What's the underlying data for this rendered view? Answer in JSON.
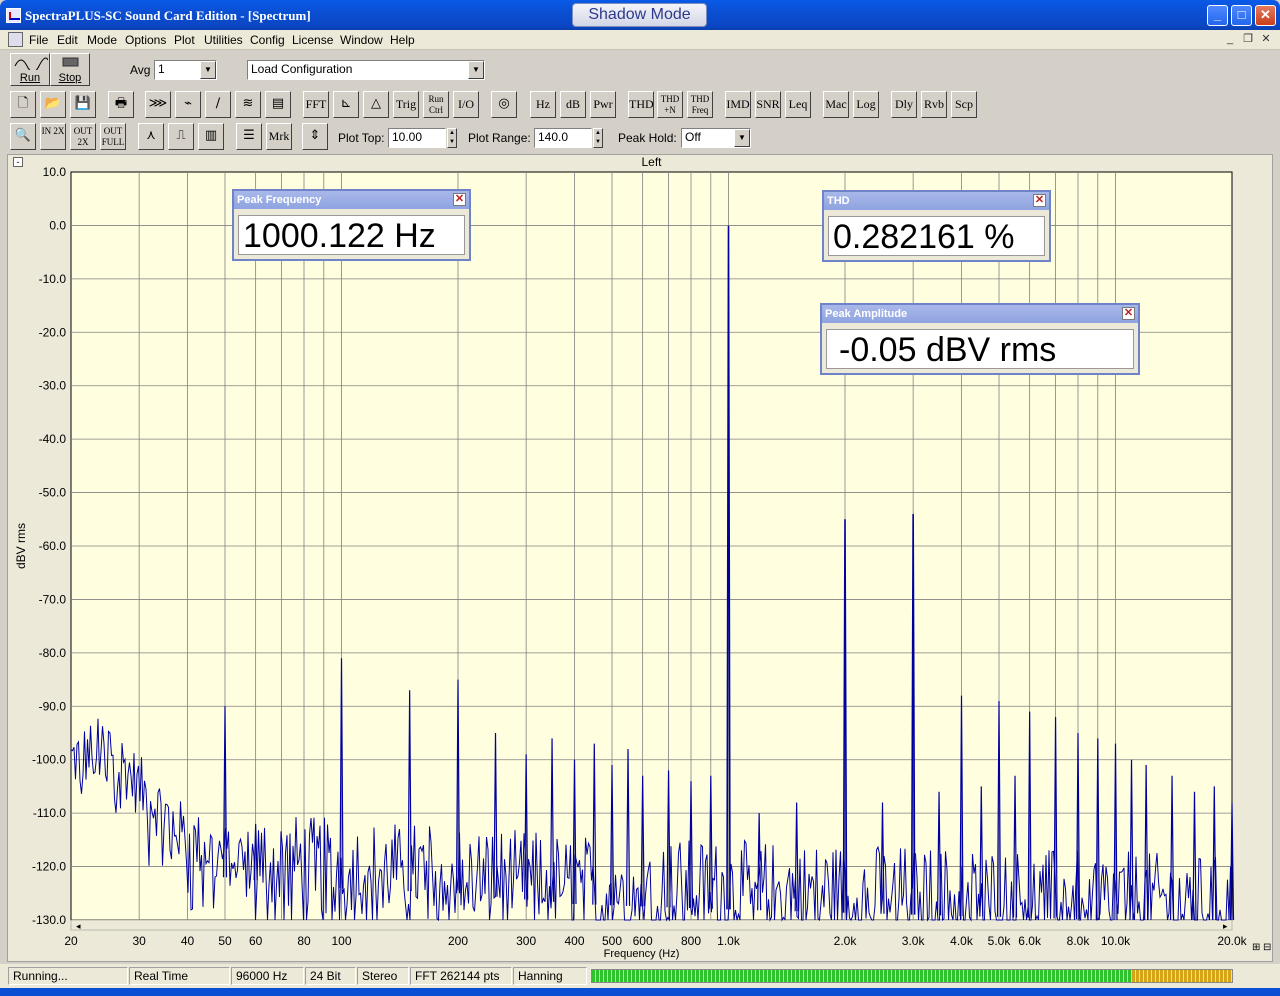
{
  "window": {
    "title": "SpectraPLUS-SC Sound Card Edition - [Spectrum]",
    "shadow_mode": "Shadow Mode"
  },
  "menu": [
    "File",
    "Edit",
    "Mode",
    "Options",
    "Plot",
    "Utilities",
    "Config",
    "License",
    "Window",
    "Help"
  ],
  "toolbar1": {
    "run_label": "Run",
    "stop_label": "Stop",
    "avg_label": "Avg",
    "avg_value": "1",
    "config_value": "Load Configuration"
  },
  "toolbar2": {
    "icon_buttons": [
      "new-file-icon",
      "open-folder-icon",
      "save-disk-icon",
      "print-icon",
      "record-icon",
      "analyze-icon",
      "ramp-icon",
      "waterfall-icon",
      "spectrogram-icon"
    ],
    "text_buttons": [
      "FFT",
      "Trig",
      "Run Ctrl",
      "I/O",
      "Hz",
      "dB",
      "Pwr",
      "THD",
      "THD +N",
      "THD Freq",
      "IMD",
      "SNR",
      "Leq",
      "Mac",
      "Log",
      "Dly",
      "Rvb",
      "Scp"
    ]
  },
  "toolbar3": {
    "zoom_buttons": [
      "IN 2X",
      "OUT 2X",
      "OUT FULL"
    ],
    "marker_label": "Mrk",
    "plot_top_label": "Plot Top:",
    "plot_top_value": "10.00",
    "plot_range_label": "Plot Range:",
    "plot_range_value": "140.0",
    "peak_hold_label": "Peak Hold:",
    "peak_hold_value": "Off"
  },
  "meters": {
    "peak_frequency": {
      "title": "Peak Frequency",
      "value": "1000.122 Hz"
    },
    "thd": {
      "title": "THD",
      "value": "0.282161 %"
    },
    "peak_amplitude": {
      "title": "Peak Amplitude",
      "value": "-0.05 dBV rms"
    }
  },
  "status": {
    "state": "Running...",
    "mode": "Real Time",
    "sample_rate": "96000 Hz",
    "bit_depth": "24 Bit",
    "channels": "Stereo",
    "fft_size": "FFT 262144 pts",
    "window": "Hanning"
  },
  "colors": {
    "plot_background": "#ffffe0",
    "trace": "#0000a0",
    "grid": "#808080"
  },
  "chart_data": {
    "type": "line",
    "title": "Left",
    "xlabel": "Frequency (Hz)",
    "ylabel": "dBV rms",
    "x_scale": "log",
    "xlim": [
      20,
      20000
    ],
    "ylim": [
      -130,
      10
    ],
    "grid": true,
    "y_ticks": [
      "10.0",
      "0.0",
      "-10.0",
      "-20.0",
      "-30.0",
      "-40.0",
      "-50.0",
      "-60.0",
      "-70.0",
      "-80.0",
      "-90.0",
      "-100.0",
      "-110.0",
      "-120.0",
      "-130.0"
    ],
    "x_ticks": [
      {
        "value": 20,
        "label": "20"
      },
      {
        "value": 30,
        "label": "30"
      },
      {
        "value": 40,
        "label": "40"
      },
      {
        "value": 50,
        "label": "50"
      },
      {
        "value": 60,
        "label": "60"
      },
      {
        "value": 80,
        "label": "80"
      },
      {
        "value": 100,
        "label": "100"
      },
      {
        "value": 200,
        "label": "200"
      },
      {
        "value": 300,
        "label": "300"
      },
      {
        "value": 400,
        "label": "400"
      },
      {
        "value": 500,
        "label": "500"
      },
      {
        "value": 600,
        "label": "600"
      },
      {
        "value": 800,
        "label": "800"
      },
      {
        "value": 1000,
        "label": "1.0k"
      },
      {
        "value": 2000,
        "label": "2.0k"
      },
      {
        "value": 3000,
        "label": "3.0k"
      },
      {
        "value": 4000,
        "label": "4.0k"
      },
      {
        "value": 5000,
        "label": "5.0k"
      },
      {
        "value": 6000,
        "label": "6.0k"
      },
      {
        "value": 8000,
        "label": "8.0k"
      },
      {
        "value": 10000,
        "label": "10.0k"
      },
      {
        "value": 20000,
        "label": "20.0k"
      }
    ],
    "noise_floor": [
      [
        20,
        -100
      ],
      [
        22,
        -99
      ],
      [
        25,
        -97
      ],
      [
        30,
        -105
      ],
      [
        35,
        -110
      ],
      [
        40,
        -115
      ],
      [
        50,
        -118
      ],
      [
        70,
        -119
      ],
      [
        100,
        -120
      ],
      [
        200,
        -121
      ],
      [
        400,
        -123
      ],
      [
        1000,
        -124
      ],
      [
        3000,
        -125
      ],
      [
        10000,
        -126
      ],
      [
        20000,
        -127
      ]
    ],
    "peaks": [
      {
        "x": 50,
        "y": -90
      },
      {
        "x": 60,
        "y": -112
      },
      {
        "x": 100,
        "y": -81
      },
      {
        "x": 150,
        "y": -87
      },
      {
        "x": 200,
        "y": -85
      },
      {
        "x": 250,
        "y": -95
      },
      {
        "x": 300,
        "y": -99
      },
      {
        "x": 350,
        "y": -96
      },
      {
        "x": 400,
        "y": -100
      },
      {
        "x": 450,
        "y": -97
      },
      {
        "x": 500,
        "y": -101
      },
      {
        "x": 550,
        "y": -98
      },
      {
        "x": 600,
        "y": -103
      },
      {
        "x": 700,
        "y": -102
      },
      {
        "x": 800,
        "y": -104
      },
      {
        "x": 900,
        "y": -103
      },
      {
        "x": 1000,
        "y": -0.05
      },
      {
        "x": 1200,
        "y": -110
      },
      {
        "x": 1500,
        "y": -108
      },
      {
        "x": 2000,
        "y": -55
      },
      {
        "x": 2500,
        "y": -108
      },
      {
        "x": 3000,
        "y": -54
      },
      {
        "x": 3500,
        "y": -106
      },
      {
        "x": 4000,
        "y": -88
      },
      {
        "x": 4500,
        "y": -105
      },
      {
        "x": 5000,
        "y": -89
      },
      {
        "x": 5500,
        "y": -103
      },
      {
        "x": 6000,
        "y": -91
      },
      {
        "x": 7000,
        "y": -92
      },
      {
        "x": 8000,
        "y": -95
      },
      {
        "x": 9000,
        "y": -96
      },
      {
        "x": 10000,
        "y": -97
      },
      {
        "x": 11000,
        "y": -100
      },
      {
        "x": 12000,
        "y": -101
      },
      {
        "x": 14000,
        "y": -103
      },
      {
        "x": 16000,
        "y": -106
      },
      {
        "x": 18000,
        "y": -105
      },
      {
        "x": 20000,
        "y": -108
      }
    ]
  }
}
